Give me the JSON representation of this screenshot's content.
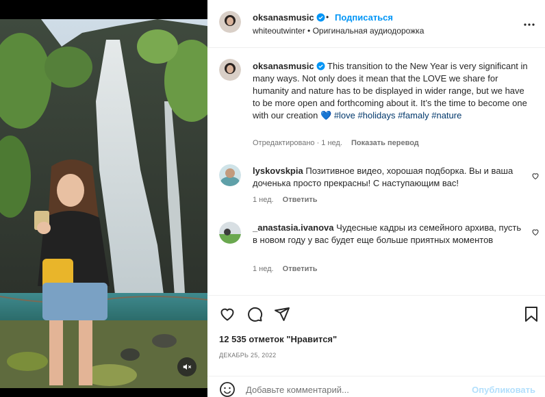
{
  "post": {
    "username": "oksanasmusic",
    "separator": "•",
    "follow_label": "Подписаться",
    "audio_label": "whiteoutwinter • Оригинальная аудиодорожка",
    "more_icon": "more-horizontal-icon"
  },
  "caption": {
    "username": "oksanasmusic",
    "text": "This transition to the New Year is very significant in many ways. Not only does it mean that the LOVE we share for humanity and nature has to be displayed in wider range, but we have to be more open and forthcoming about it. It’s the time to become one with our creation ",
    "heart_emoji": "💙",
    "hashtags": [
      "#love",
      "#holidays",
      "#famaly",
      "#nature"
    ],
    "edited": "Отредактировано · 1 нед.",
    "show_translation": "Показать перевод"
  },
  "comments": [
    {
      "username": "lyskovskpia",
      "text": "Позитивное видео, хорошая подборка. Вы и ваша доченька просто прекрасны! С наступающим вас!",
      "time": "1 нед.",
      "reply": "Ответить"
    },
    {
      "username": "_anastasia.ivanova",
      "text": "Чудесные кадры из семейного архива, пусть в новом году у вас будет еще больше приятных моментов",
      "time": "1 нед.",
      "reply": "Ответить"
    }
  ],
  "stats": {
    "likes": "12 535 отметок \"Нравится\"",
    "date": "ДЕКАБРЬ 25, 2022"
  },
  "add_comment": {
    "placeholder": "Добавьте комментарий...",
    "publish_label": "Опубликовать"
  },
  "colors": {
    "accent": "#0095f6",
    "verified": "#0095f6",
    "hashtag": "#00376b",
    "muted": "#737373"
  }
}
